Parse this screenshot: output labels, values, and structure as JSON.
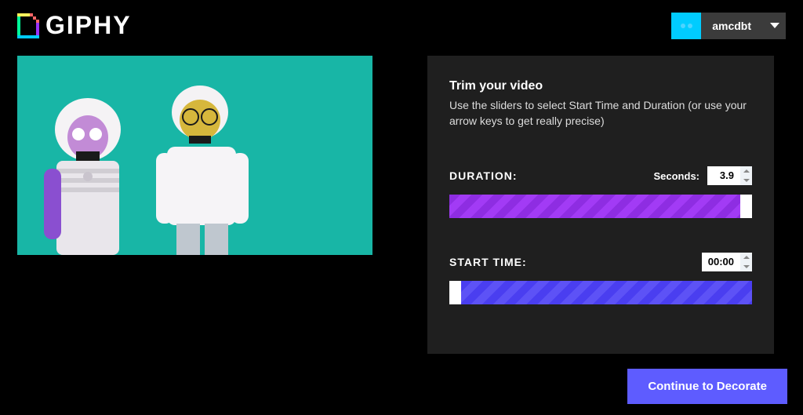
{
  "brand": {
    "name": "GIPHY"
  },
  "user": {
    "username": "amcdbt"
  },
  "panel": {
    "title": "Trim your video",
    "description": "Use the sliders to select Start Time and Duration (or use your arrow keys to get really precise)",
    "duration": {
      "label": "DURATION:",
      "unit_label": "Seconds:",
      "value": "3.9",
      "fill_percent": 96
    },
    "start_time": {
      "label": "START TIME:",
      "value": "00:00",
      "offset_percent": 4,
      "fill_percent": 96
    }
  },
  "cta": {
    "label": "Continue to Decorate"
  }
}
